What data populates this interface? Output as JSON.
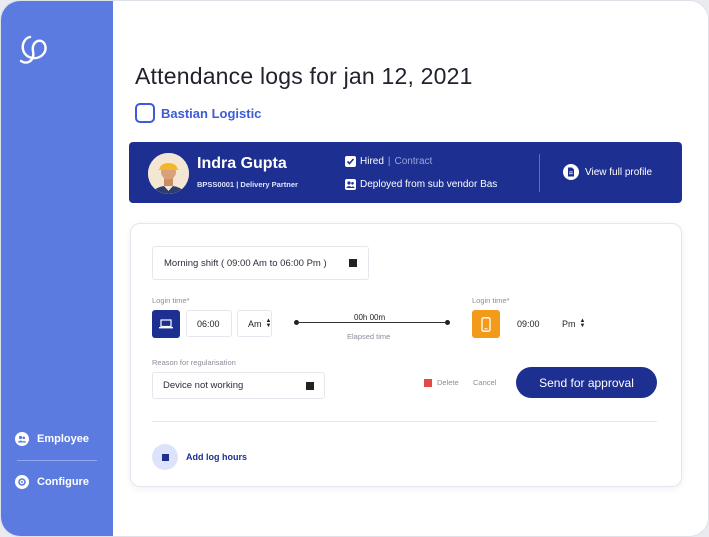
{
  "colors": {
    "sidebar": "#5b7be0",
    "brand": "#1d2f91",
    "accent": "#3d5bd6",
    "login_icon_1": "#1d2f91",
    "login_icon_2": "#f49a1a",
    "delete": "#e24a4a"
  },
  "sidebar": {
    "logo_icon": "swirl-logo-icon",
    "items": [
      {
        "label": "Employee",
        "icon": "people-icon"
      },
      {
        "label": "Configure",
        "icon": "gear-icon"
      }
    ]
  },
  "page": {
    "title": "Attendance logs for jan 12, 2021",
    "company": "Bastian Logistic"
  },
  "employee": {
    "name": "Indra Gupta",
    "id": "BPSS0001",
    "role": "Delivery Partner",
    "status_checked": "Hired",
    "status_other": "Contract",
    "deployment": "Deployed from sub vendor Bas",
    "view_profile": "View full profile"
  },
  "attendance": {
    "shift": "Morning shift ( 09:00 Am to 06:00 Pm )",
    "login_label": "Login time*",
    "login_time_1": "06:00",
    "period_1": "Am",
    "elapsed_value": "00h 00m",
    "elapsed_caption": "Elapsed time",
    "login_label_2": "Login time*",
    "login_time_2": "09:00",
    "period_2": "Pm",
    "reason_label": "Reason for regularisation",
    "reason_value": "Device not working",
    "delete_label": "Delete",
    "cancel_label": "Cancel",
    "send_label": "Send for approval",
    "add_log_label": "Add log hours"
  }
}
